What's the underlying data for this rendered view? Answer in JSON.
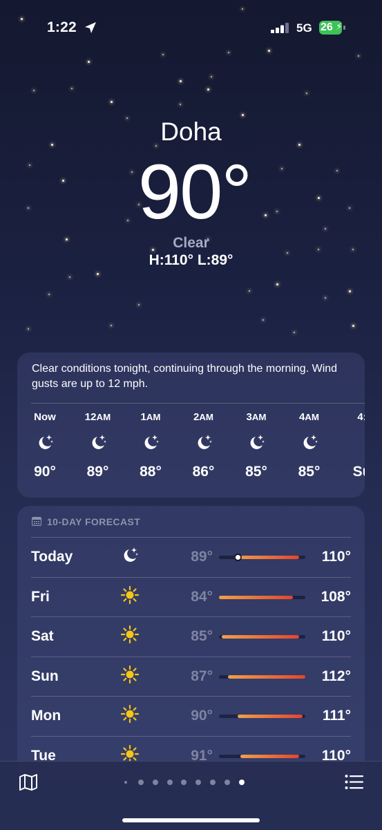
{
  "status_bar": {
    "time": "1:22",
    "network": "5G",
    "battery": "26"
  },
  "header": {
    "city": "Doha",
    "temperature": "90°",
    "condition": "Clear",
    "high_low": "H:110°  L:89°"
  },
  "hourly": {
    "summary": "Clear conditions tonight, continuing through the morning. Wind gusts are up to 12 mph.",
    "hours": [
      {
        "label": "Now",
        "suffix": "",
        "icon": "moon-stars-icon",
        "temp": "90°"
      },
      {
        "label": "12",
        "suffix": "AM",
        "icon": "moon-stars-icon",
        "temp": "89°"
      },
      {
        "label": "1",
        "suffix": "AM",
        "icon": "moon-stars-icon",
        "temp": "88°"
      },
      {
        "label": "2",
        "suffix": "AM",
        "icon": "moon-stars-icon",
        "temp": "86°"
      },
      {
        "label": "3",
        "suffix": "AM",
        "icon": "moon-stars-icon",
        "temp": "85°"
      },
      {
        "label": "4",
        "suffix": "AM",
        "icon": "moon-stars-icon",
        "temp": "85°"
      },
      {
        "label": "4:",
        "suffix": "",
        "icon": "",
        "temp": "Su"
      }
    ]
  },
  "forecast": {
    "title": "10-DAY FORECAST",
    "range_min": 84,
    "range_max": 112,
    "days": [
      {
        "day": "Today",
        "icon": "moon-stars-icon",
        "low": "89°",
        "high": "110°",
        "low_val": 89,
        "high_val": 110,
        "current_val": 90
      },
      {
        "day": "Fri",
        "icon": "sun-icon",
        "low": "84°",
        "high": "108°",
        "low_val": 84,
        "high_val": 108
      },
      {
        "day": "Sat",
        "icon": "sun-icon",
        "low": "85°",
        "high": "110°",
        "low_val": 85,
        "high_val": 110
      },
      {
        "day": "Sun",
        "icon": "sun-icon",
        "low": "87°",
        "high": "112°",
        "low_val": 87,
        "high_val": 112
      },
      {
        "day": "Mon",
        "icon": "sun-icon",
        "low": "90°",
        "high": "111°",
        "low_val": 90,
        "high_val": 111
      },
      {
        "day": "Tue",
        "icon": "sun-icon",
        "low": "91°",
        "high": "110°",
        "low_val": 91,
        "high_val": 110
      }
    ]
  },
  "page_dots": {
    "count": 9,
    "active_index": 8
  },
  "colors": {
    "battery": "#3fc157",
    "temp_bar_cool": "#f0a04a",
    "temp_bar_hot": "#e2452e",
    "sun": "#f5c518"
  }
}
